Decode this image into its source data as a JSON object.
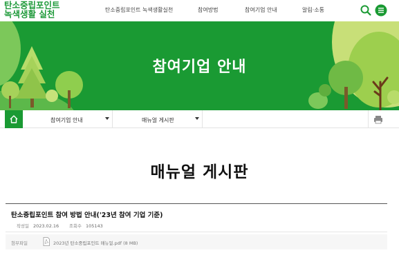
{
  "header": {
    "logo_line1": "탄소중립포인트",
    "logo_line2": "녹색생활 실천",
    "nav": [
      "탄소중립포인트 녹색생활실천",
      "참여방법",
      "참여기업 안내",
      "알림·소통"
    ]
  },
  "banner": {
    "title": "참여기업 안내"
  },
  "subnav": {
    "dropdown1": "참여기업 안내",
    "dropdown2": "매뉴얼 게시판"
  },
  "main": {
    "page_title": "매뉴얼 게시판",
    "post": {
      "title": "탄소중립포인트 참여 방법 안내('23년 참여 기업 기준)",
      "author_label": "작성일",
      "date": "2023.02.16",
      "views_label": "조회수",
      "views": "105143",
      "attach_label": "첨부파일",
      "attach_file": "2023년 탄소중립포인트 매뉴얼.pdf (8 MB)"
    }
  },
  "colors": {
    "brand_green": "#1a9a33",
    "logo_green": "#1f9a3a"
  }
}
